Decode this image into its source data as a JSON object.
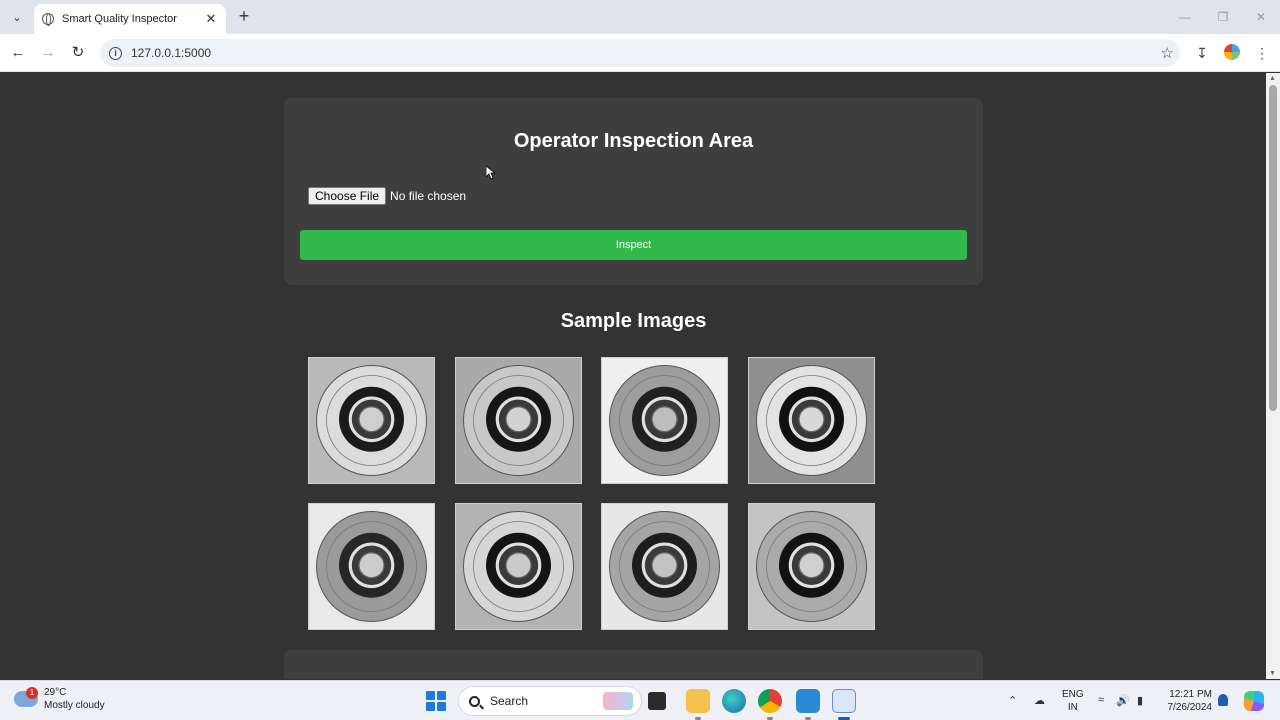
{
  "browser": {
    "tab_title": "Smart Quality Inspector",
    "url": "127.0.0.1:5000"
  },
  "page": {
    "inspection": {
      "title": "Operator Inspection Area",
      "choose_file_label": "Choose File",
      "file_status": "No file chosen",
      "inspect_label": "Inspect"
    },
    "samples": {
      "title": "Sample Images",
      "images": [
        {
          "bg": "#b9b9b9",
          "rim": "#dcdcdc",
          "ring": "#1a1a1a",
          "hub": "#cfcfcf"
        },
        {
          "bg": "#a9a9a9",
          "rim": "#c8c8c8",
          "ring": "#161616",
          "hub": "#d2d2d2"
        },
        {
          "bg": "#efefef",
          "rim": "#9d9d9d",
          "ring": "#202020",
          "hub": "#bdbdbd"
        },
        {
          "bg": "#8f8f8f",
          "rim": "#e3e3e3",
          "ring": "#111111",
          "hub": "#d8d8d8"
        },
        {
          "bg": "#e9e9e9",
          "rim": "#9a9a9a",
          "ring": "#262626",
          "hub": "#cdcdcd"
        },
        {
          "bg": "#b3b3b3",
          "rim": "#d6d6d6",
          "ring": "#141414",
          "hub": "#cacaca"
        },
        {
          "bg": "#e7e7e7",
          "rim": "#a5a5a5",
          "ring": "#1d1d1d",
          "hub": "#c4c4c4"
        },
        {
          "bg": "#c4c4c4",
          "rim": "#aaaaaa",
          "ring": "#121212",
          "hub": "#d0d0d0"
        }
      ]
    }
  },
  "taskbar": {
    "weather_alert_count": "1",
    "temperature": "29°C",
    "condition": "Mostly cloudy",
    "search_placeholder": "Search",
    "lang_primary": "ENG",
    "lang_region": "IN",
    "time": "12:21 PM",
    "date": "7/26/2024"
  }
}
